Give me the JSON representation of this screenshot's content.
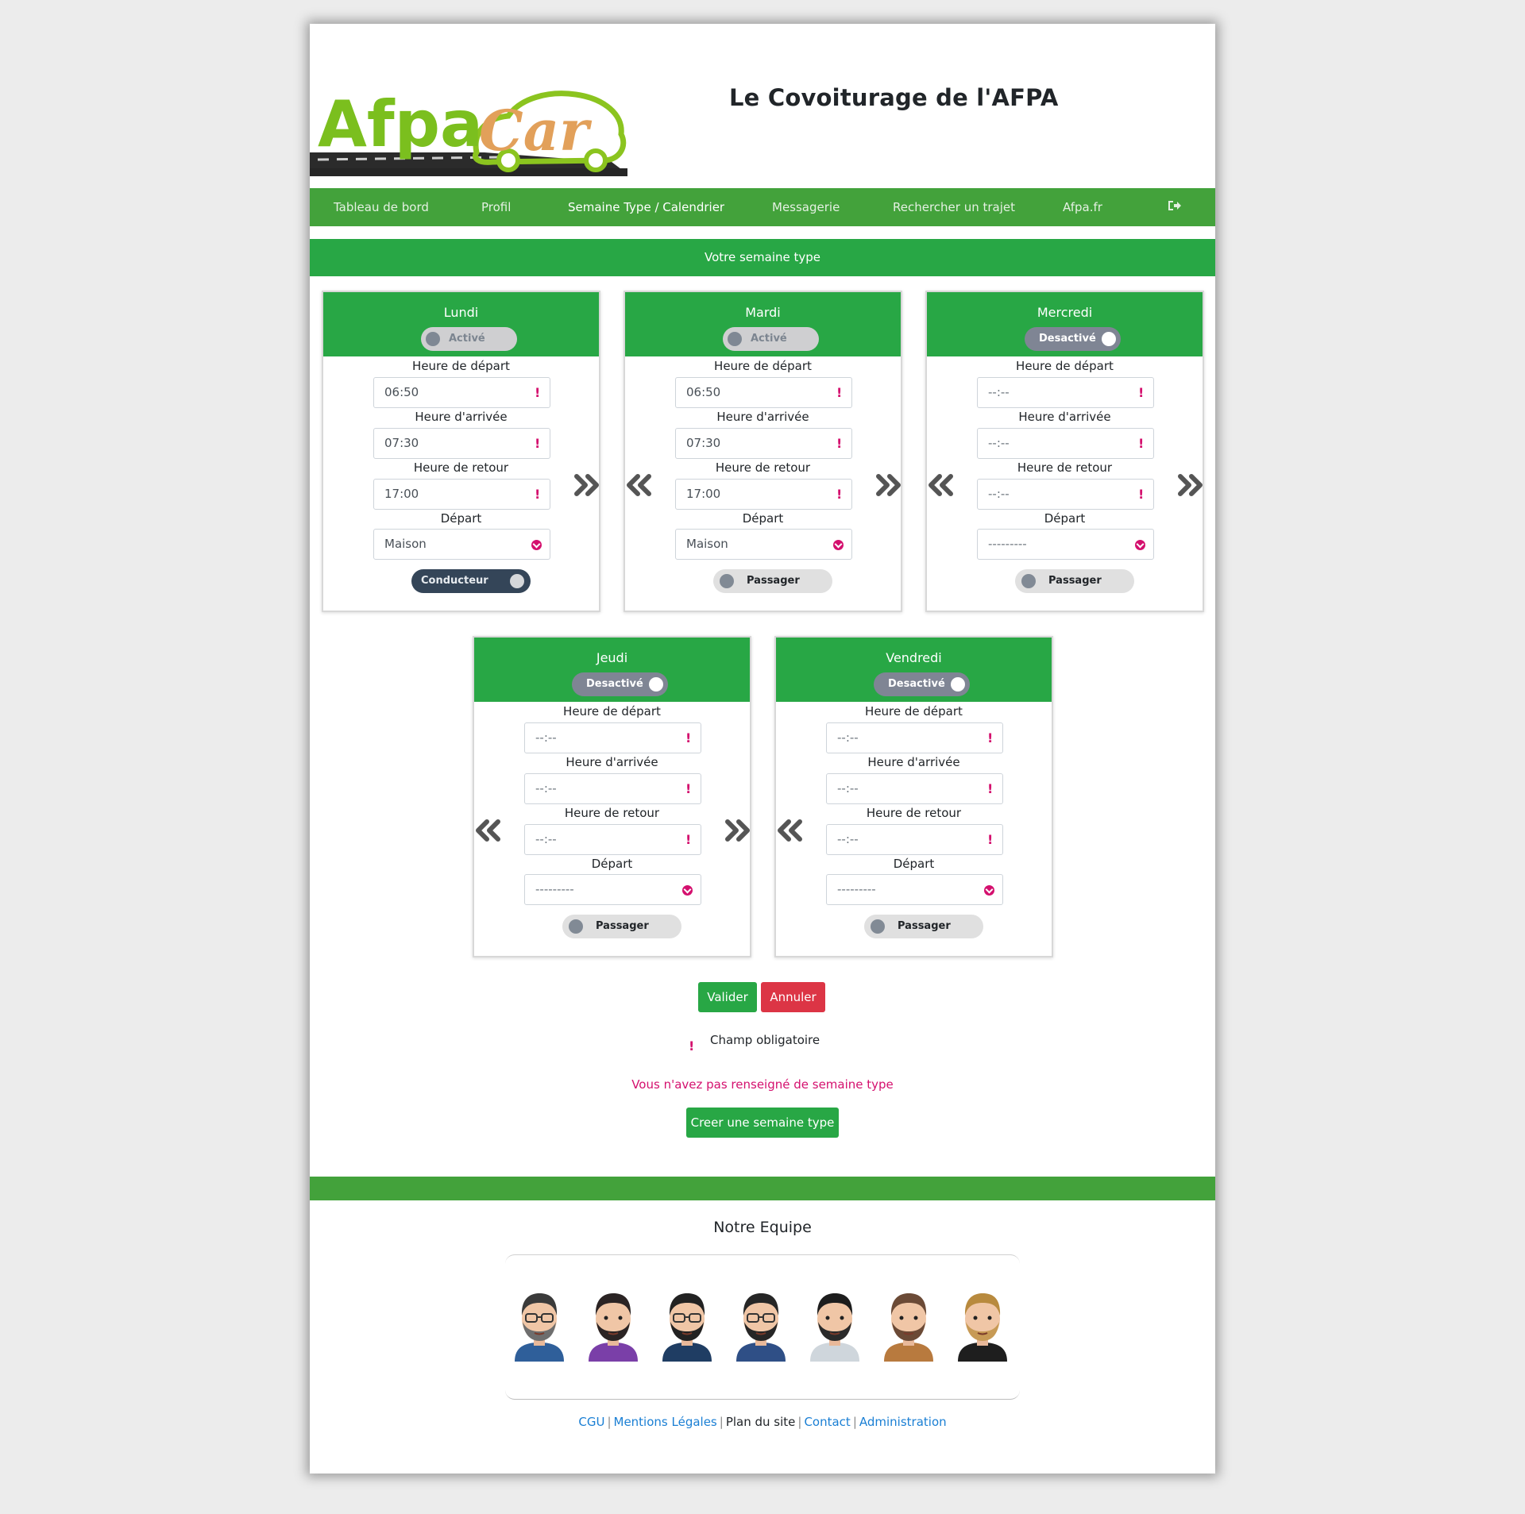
{
  "header": {
    "logo": {
      "text_afpa": "Afpa",
      "text_car": "Car"
    },
    "site_title": "Le Covoiturage de l'AFPA"
  },
  "nav": {
    "items": [
      {
        "label": "Tableau de bord",
        "active": false
      },
      {
        "label": "Profil",
        "active": false
      },
      {
        "label": "Semaine Type / Calendrier",
        "active": true
      },
      {
        "label": "Messagerie",
        "active": false
      },
      {
        "label": "Rechercher un trajet",
        "active": false
      },
      {
        "label": "Afpa.fr",
        "active": false
      }
    ],
    "logout_icon": "sign-out-icon"
  },
  "banner": {
    "title": "Votre semaine type"
  },
  "labels": {
    "depart_time": "Heure de départ",
    "arrival_time": "Heure d'arrivée",
    "return_time": "Heure de retour",
    "depart_place": "Départ"
  },
  "days": [
    {
      "name": "Lundi",
      "status": "Activé",
      "enabled": true,
      "depart": "06:50",
      "arrivee": "07:30",
      "retour": "17:00",
      "lieu": "Maison",
      "role": "Conducteur"
    },
    {
      "name": "Mardi",
      "status": "Activé",
      "enabled": true,
      "depart": "06:50",
      "arrivee": "07:30",
      "retour": "17:00",
      "lieu": "Maison",
      "role": "Passager"
    },
    {
      "name": "Mercredi",
      "status": "Desactivé",
      "enabled": false,
      "depart": "--:--",
      "arrivee": "--:--",
      "retour": "--:--",
      "lieu": "---------",
      "role": "Passager"
    },
    {
      "name": "Jeudi",
      "status": "Desactivé",
      "enabled": false,
      "depart": "--:--",
      "arrivee": "--:--",
      "retour": "--:--",
      "lieu": "---------",
      "role": "Passager"
    },
    {
      "name": "Vendredi",
      "status": "Desactivé",
      "enabled": false,
      "depart": "--:--",
      "arrivee": "--:--",
      "retour": "--:--",
      "lieu": "---------",
      "role": "Passager"
    }
  ],
  "actions": {
    "validate": "Valider",
    "cancel": "Annuler",
    "required_legend": "Champ obligatoire",
    "required_mark": "!",
    "no_week_message": "Vous n'avez pas renseigné de semaine type",
    "create_week": "Creer une semaine type"
  },
  "footer": {
    "team_title": "Notre Equipe",
    "avatars": [
      {
        "shirt": "#2f5f9a",
        "hair": "#3a3a3a",
        "beard": "#6e6e6e",
        "glasses": true
      },
      {
        "shirt": "#7a3fa8",
        "hair": "#2b2424",
        "beard": "#2b2424",
        "glasses": false
      },
      {
        "shirt": "#1f3d63",
        "hair": "#222222",
        "beard": "#222222",
        "glasses": true
      },
      {
        "shirt": "#2f4f86",
        "hair": "#262626",
        "beard": "#262626",
        "glasses": true
      },
      {
        "shirt": "#cfd6dc",
        "hair": "#1d1d1d",
        "beard": "#2a2a2a",
        "glasses": false
      },
      {
        "shirt": "#b87a3e",
        "hair": "#6b4a36",
        "beard": "#6b4a36",
        "glasses": false
      },
      {
        "shirt": "#1e1e1e",
        "hair": "#b88a3e",
        "beard": "#c79a55",
        "glasses": false
      }
    ],
    "links": [
      {
        "label": "CGU",
        "link": true
      },
      {
        "label": "Mentions Légales",
        "link": true
      },
      {
        "label": "Plan du site",
        "link": false
      },
      {
        "label": "Contact",
        "link": true
      },
      {
        "label": "Administration",
        "link": true
      }
    ]
  },
  "colors": {
    "nav_green": "#43a23b",
    "card_green": "#28a745",
    "danger": "#dc3545",
    "required_pink": "#d4106e",
    "link_blue": "#1a7fd4"
  }
}
